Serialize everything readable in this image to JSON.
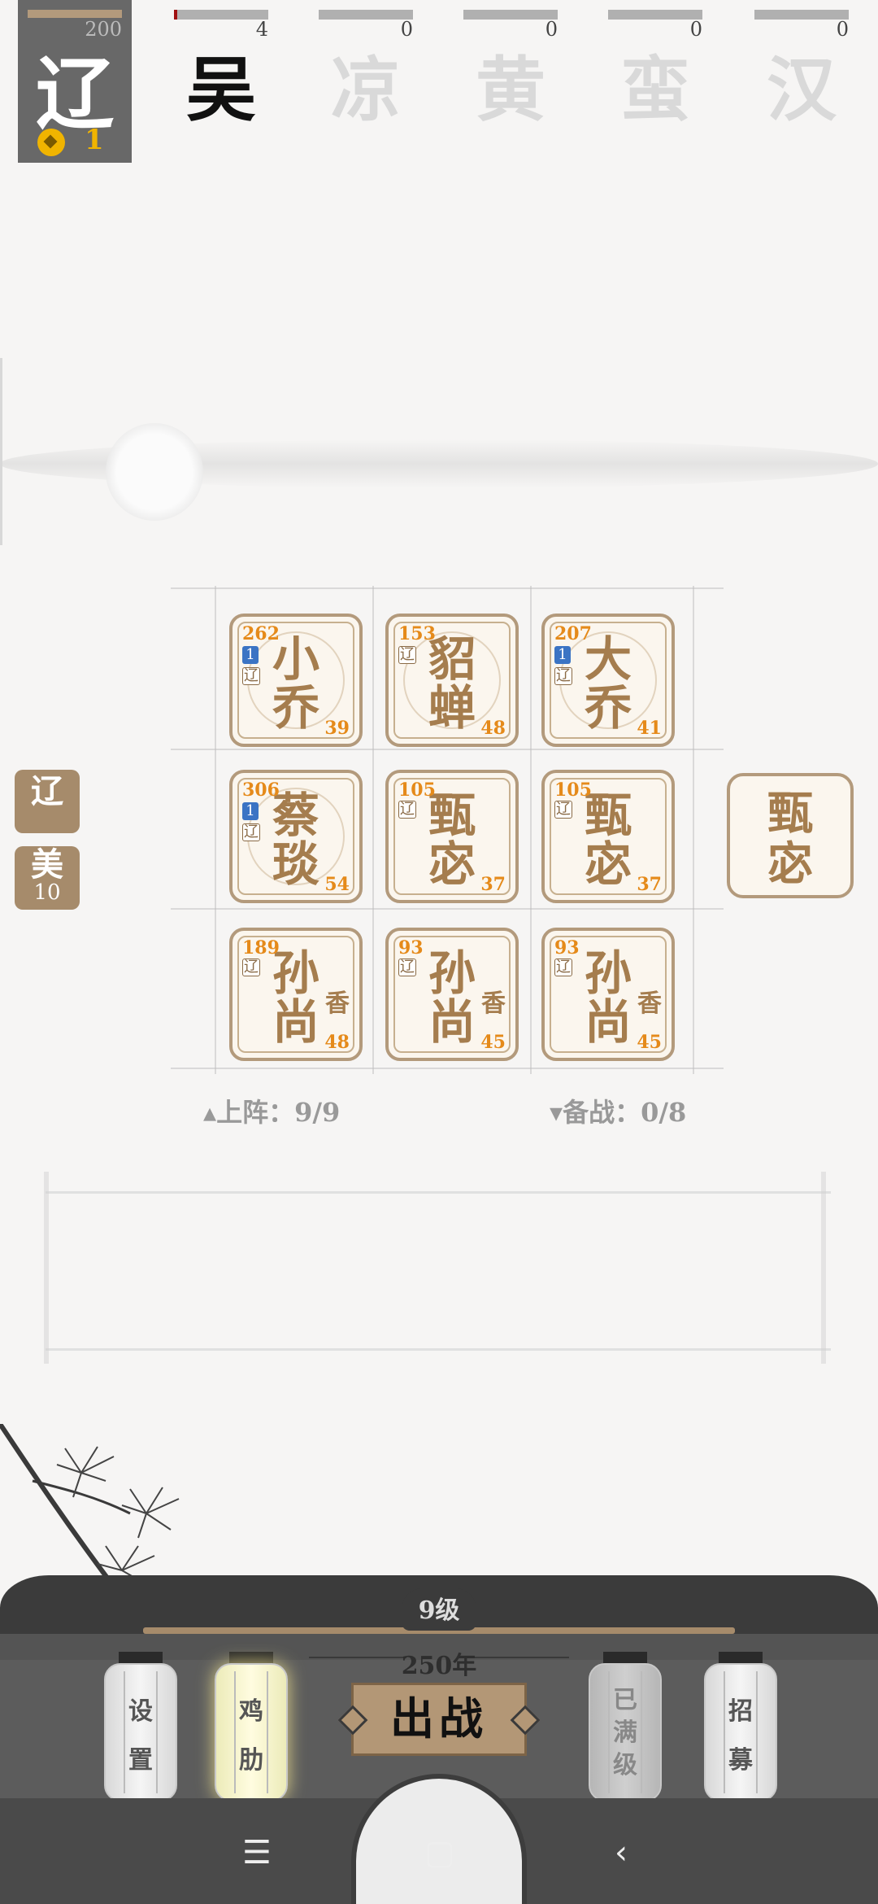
{
  "factions": {
    "current": {
      "glyph": "辽",
      "score": "200",
      "coins": "1"
    },
    "others": [
      {
        "glyph": "吴",
        "score": "4",
        "active": true
      },
      {
        "glyph": "凉",
        "score": "0",
        "active": false
      },
      {
        "glyph": "黄",
        "score": "0",
        "active": false
      },
      {
        "glyph": "蛮",
        "score": "0",
        "active": false
      },
      {
        "glyph": "汉",
        "score": "0",
        "active": false
      }
    ]
  },
  "side_badges": [
    {
      "line1": "辽",
      "line2": ""
    },
    {
      "line1": "美",
      "line2": "10"
    }
  ],
  "board": [
    {
      "name": "小\n乔",
      "power": "262",
      "level_tag": "1",
      "faction_tag": "辽",
      "level": "39",
      "side": ""
    },
    {
      "name": "貂\n蝉",
      "power": "153",
      "level_tag": "",
      "faction_tag": "辽",
      "level": "48",
      "side": ""
    },
    {
      "name": "大\n乔",
      "power": "207",
      "level_tag": "1",
      "faction_tag": "辽",
      "level": "41",
      "side": ""
    },
    {
      "name": "蔡\n琰",
      "power": "306",
      "level_tag": "1",
      "faction_tag": "辽",
      "level": "54",
      "side": ""
    },
    {
      "name": "甄\n宓",
      "power": "105",
      "level_tag": "",
      "faction_tag": "辽",
      "level": "37",
      "side": ""
    },
    {
      "name": "甄\n宓",
      "power": "105",
      "level_tag": "",
      "faction_tag": "辽",
      "level": "37",
      "side": ""
    },
    {
      "name": "孙\n尚",
      "power": "189",
      "level_tag": "",
      "faction_tag": "辽",
      "level": "48",
      "side": "香"
    },
    {
      "name": "孙\n尚",
      "power": "93",
      "level_tag": "",
      "faction_tag": "辽",
      "level": "45",
      "side": "香"
    },
    {
      "name": "孙\n尚",
      "power": "93",
      "level_tag": "",
      "faction_tag": "辽",
      "level": "45",
      "side": "香"
    }
  ],
  "bench_card": {
    "name": "甄\n宓"
  },
  "counters": {
    "deployed": "▴上阵：9/9",
    "reserve": "▾备战：0/8"
  },
  "bottom": {
    "level": "9级",
    "year": "250年",
    "fight_label": "出战",
    "lanterns": [
      {
        "label": "设\n置",
        "state": "normal"
      },
      {
        "label": "鸡\n肋",
        "state": "glow"
      },
      {
        "label": "已\n满\n级",
        "state": "dim"
      },
      {
        "label": "招\n募",
        "state": "normal"
      }
    ]
  },
  "nav": {
    "menu": "☰",
    "home": "▢",
    "back": "‹"
  }
}
